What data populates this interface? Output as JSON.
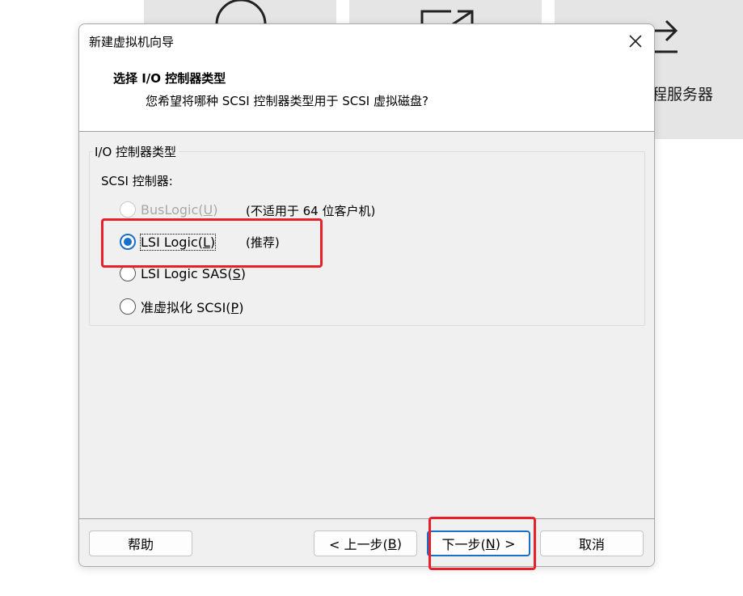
{
  "background": {
    "tile3_label": "程服务器"
  },
  "dialog": {
    "title": "新建虚拟机向导",
    "header": {
      "title": "选择 I/O 控制器类型",
      "subtitle": "您希望将哪种 SCSI 控制器类型用于 SCSI 虚拟磁盘?"
    },
    "group_label": "I/O 控制器类型",
    "scsi_label": "SCSI 控制器:",
    "options": [
      {
        "label": "BusLogic(",
        "mnemonic": "U",
        "suffix": ")",
        "note": "(不适用于 64 位客户机)",
        "state": "disabled"
      },
      {
        "label": "LSI Logic(",
        "mnemonic": "L",
        "suffix": ")",
        "note": "(推荐)",
        "state": "checked"
      },
      {
        "label": "LSI Logic SAS(",
        "mnemonic": "S",
        "suffix": ")",
        "note": "",
        "state": "unchecked"
      },
      {
        "label": "准虚拟化 SCSI(",
        "mnemonic": "P",
        "suffix": ")",
        "note": "",
        "state": "unchecked"
      }
    ],
    "buttons": {
      "help": "帮助",
      "back_prefix": "< 上一步(",
      "back_mnemonic": "B",
      "back_suffix": ")",
      "next_prefix": "下一步(",
      "next_mnemonic": "N",
      "next_suffix": ") >",
      "cancel": "取消"
    }
  },
  "colors": {
    "accent": "#1a6fc9",
    "highlight": "#e8202a",
    "panel_bg": "#f0f0f0",
    "tile_bg": "#e5e5e5"
  }
}
